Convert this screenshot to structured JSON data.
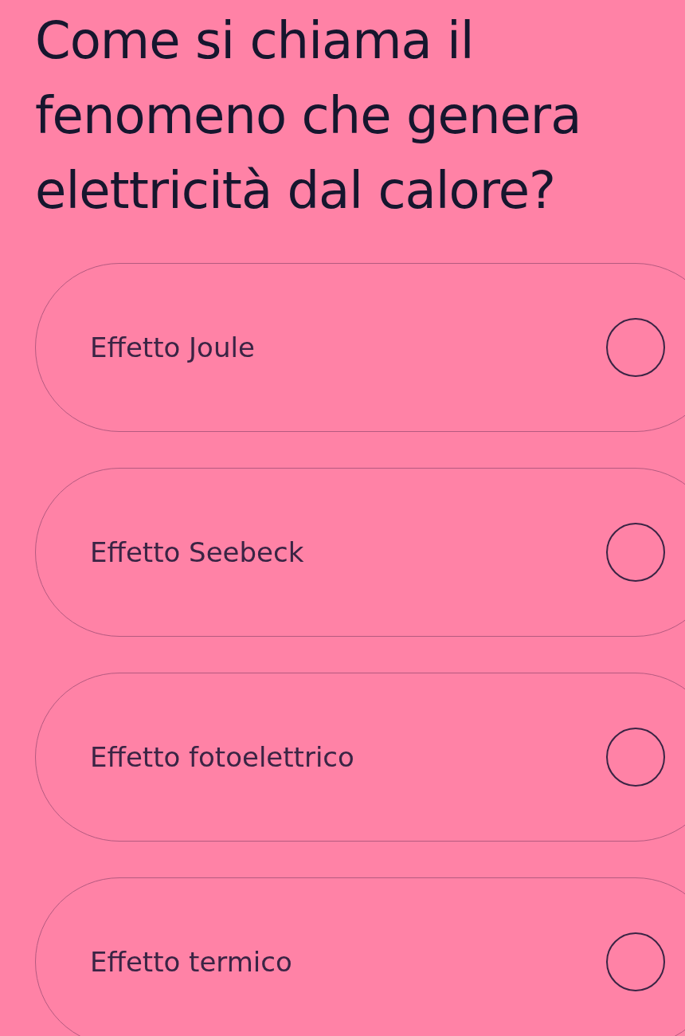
{
  "question": "Come si chiama il fenomeno che genera elettricità dal calore?",
  "options": [
    {
      "label": "Effetto Joule",
      "selected": false
    },
    {
      "label": "Effetto Seebeck",
      "selected": false
    },
    {
      "label": "Effetto fotoelettrico",
      "selected": false
    },
    {
      "label": "Effetto termico",
      "selected": false
    }
  ]
}
